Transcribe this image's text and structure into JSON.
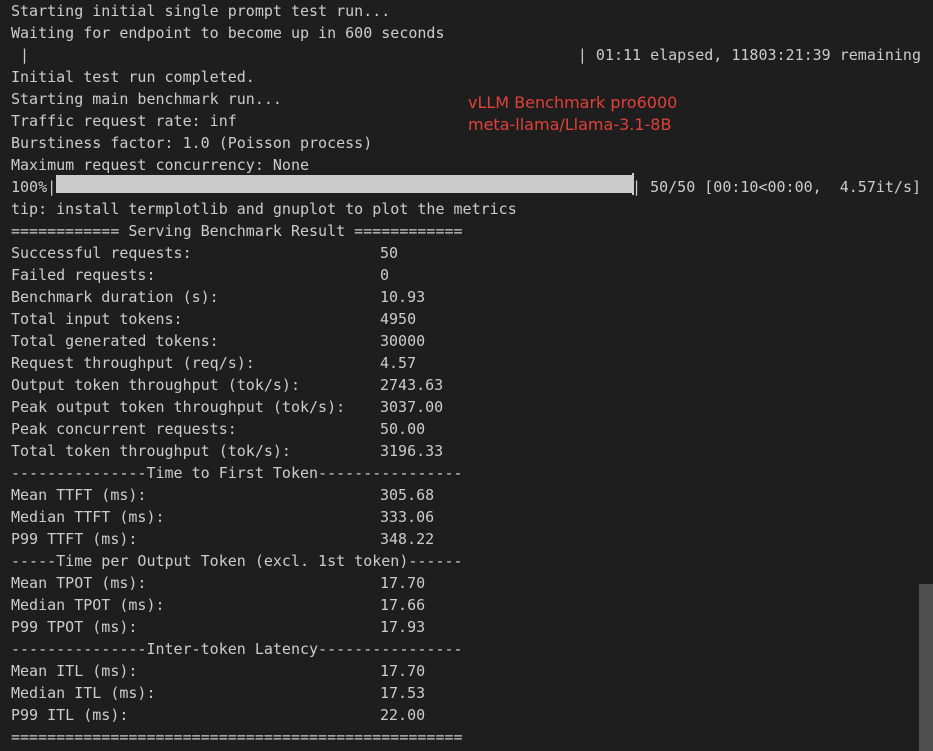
{
  "log": {
    "start_initial": "Starting initial single prompt test run...",
    "waiting": "Waiting for endpoint to become up in 600 seconds",
    "wait_bar_left": " |",
    "wait_status": "| 01:11 elapsed, 11803:21:39 remaining",
    "initial_done": "Initial test run completed.",
    "start_main": "Starting main benchmark run...",
    "traffic_rate": "Traffic request rate: inf",
    "burstiness": "Burstiness factor: 1.0 (Poisson process)",
    "max_concurrency": "Maximum request concurrency: None"
  },
  "progress": {
    "percent_label": "100%|",
    "fraction": 1.0,
    "status": "| 50/50 [00:10<00:00,  4.57it/s]"
  },
  "tip": "tip: install termplotlib and gnuplot to plot the metrics",
  "overlay": {
    "line1": "vLLM Benchmark pro6000",
    "line2": "meta-llama/Llama-3.1-8B"
  },
  "result": {
    "header": "============ Serving Benchmark Result ============",
    "metrics": [
      {
        "label": "Successful requests:",
        "value": "50"
      },
      {
        "label": "Failed requests:",
        "value": "0"
      },
      {
        "label": "Benchmark duration (s):",
        "value": "10.93"
      },
      {
        "label": "Total input tokens:",
        "value": "4950"
      },
      {
        "label": "Total generated tokens:",
        "value": "30000"
      },
      {
        "label": "Request throughput (req/s):",
        "value": "4.57"
      },
      {
        "label": "Output token throughput (tok/s):",
        "value": "2743.63"
      },
      {
        "label": "Peak output token throughput (tok/s):",
        "value": "3037.00"
      },
      {
        "label": "Peak concurrent requests:",
        "value": "50.00"
      },
      {
        "label": "Total token throughput (tok/s):",
        "value": "3196.33"
      }
    ],
    "ttft_header": "---------------Time to First Token----------------",
    "ttft": [
      {
        "label": "Mean TTFT (ms):",
        "value": "305.68"
      },
      {
        "label": "Median TTFT (ms):",
        "value": "333.06"
      },
      {
        "label": "P99 TTFT (ms):",
        "value": "348.22"
      }
    ],
    "tpot_header": "-----Time per Output Token (excl. 1st token)------",
    "tpot": [
      {
        "label": "Mean TPOT (ms):",
        "value": "17.70"
      },
      {
        "label": "Median TPOT (ms):",
        "value": "17.66"
      },
      {
        "label": "P99 TPOT (ms):",
        "value": "17.93"
      }
    ],
    "itl_header": "---------------Inter-token Latency----------------",
    "itl": [
      {
        "label": "Mean ITL (ms):",
        "value": "17.70"
      },
      {
        "label": "Median ITL (ms):",
        "value": "17.53"
      },
      {
        "label": "P99 ITL (ms):",
        "value": "22.00"
      }
    ],
    "footer": "=================================================="
  }
}
